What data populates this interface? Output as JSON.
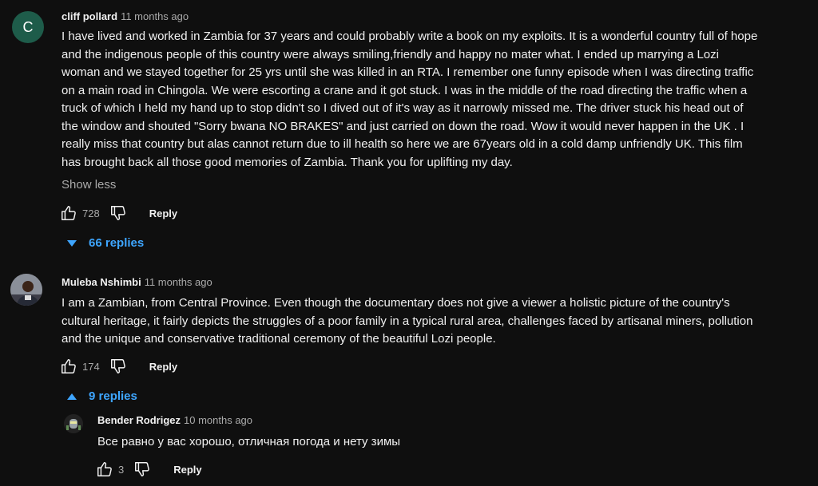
{
  "comments": [
    {
      "avatar_letter": "C",
      "avatar_color": "#1e5c4a",
      "author": "cliff pollard",
      "time": "11 months ago",
      "text": "I have lived and worked in Zambia for 37 years and could probably write a book on my exploits. It is a wonderful country full of hope\nand the indigenous people of this country were always smiling,friendly  and happy no mater what. I ended up marrying a Lozi\nwoman and we stayed together for 25 yrs until she was killed in an RTA. I remember one funny episode when I was directing traffic\non a main road in Chingola. We were escorting a crane and it got stuck. I was in the middle of the road directing the traffic  when a\ntruck of which I held my hand up to stop  didn't  so I dived out of it's way as it narrowly missed me. The driver stuck his head out of\nthe window and shouted \"Sorry bwana NO BRAKES\" and just carried on down the road. Wow it would never happen in the UK . I\nreally miss that country but alas cannot return due to ill health so here we are 67years old in a cold damp unfriendly UK. This film\nhas brought back all those good memories of Zambia. Thank you for uplifting my day.",
      "show_less": "Show less",
      "likes": "728",
      "reply_label": "Reply",
      "replies_label": "66 replies"
    },
    {
      "author": "Muleba Nshimbi",
      "time": "11 months ago",
      "text": "I am a Zambian, from Central Province. Even though the documentary does not give a viewer a holistic picture of the country's\ncultural heritage, it fairly depicts the struggles of a poor family in a typical rural area, challenges faced by artisanal miners, pollution\nand the unique and conservative traditional ceremony of the beautiful Lozi people.",
      "likes": "174",
      "reply_label": "Reply",
      "replies_label": "9 replies"
    }
  ],
  "reply": {
    "author": "Bender Rodrigez",
    "time": "10 months ago",
    "text": "Все равно у вас хорошо, отличная погода и нету зимы",
    "likes": "3",
    "reply_label": "Reply"
  },
  "colors": {
    "link": "#3ea6ff",
    "background": "#0f0f0f"
  }
}
